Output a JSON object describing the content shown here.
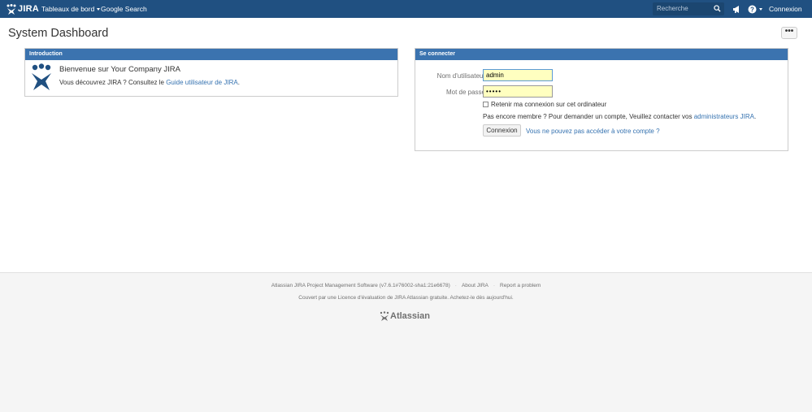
{
  "header": {
    "logo_text": "JIRA",
    "nav_dashboards": "Tableaux de bord",
    "nav_google": "Google Search",
    "search_placeholder": "Recherche",
    "login_label": "Connexion"
  },
  "page": {
    "title": "System Dashboard",
    "more_label": "•••"
  },
  "intro_gadget": {
    "title": "Introduction",
    "welcome": "Bienvenue sur Your Company JIRA",
    "desc_prefix": "Vous découvrez JIRA ? Consultez le ",
    "desc_link": "Guide utilisateur de JIRA",
    "desc_suffix": "."
  },
  "login_gadget": {
    "title": "Se connecter",
    "username_label": "Nom d'utilisateur",
    "username_value": "admin",
    "password_label": "Mot de passe",
    "password_value": "•••••",
    "remember_label": "Retenir ma connexion sur cet ordinateur",
    "not_member_text": "Pas encore membre ? Pour demander un compte, Veuillez contacter vos ",
    "admins_link": "administrateurs JIRA",
    "not_member_suffix": ".",
    "login_button": "Connexion",
    "forgot_link": "Vous ne pouvez pas accéder à votre compte ?"
  },
  "footer": {
    "software": "Atlassian JIRA Project Management Software (v7.6.1#76002-sha1:21e6678)",
    "about": "About JIRA",
    "report": "Report a problem",
    "license": "Couvert par une Licence d'évaluation de JIRA Atlassian gratuite. Achetez-le dès aujourd'hui.",
    "brand": "Atlassian"
  },
  "colors": {
    "header_bg": "#205081",
    "gadget_header_bg": "#3b73af",
    "link": "#3572b0",
    "autofill_bg": "#ffffc0"
  },
  "icons": [
    "jira-logo-icon",
    "chevron-down-icon",
    "search-icon",
    "megaphone-icon",
    "help-icon",
    "jira-figure-icon",
    "atlassian-logo-icon"
  ]
}
